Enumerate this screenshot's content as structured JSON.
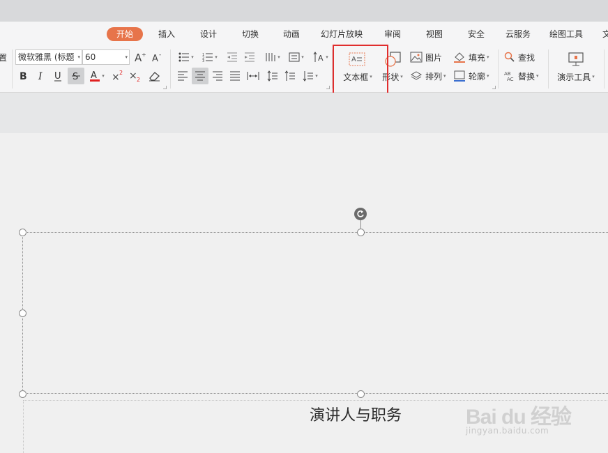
{
  "tabs": [
    {
      "label": "开始",
      "active": true
    },
    {
      "label": "插入"
    },
    {
      "label": "设计"
    },
    {
      "label": "切换"
    },
    {
      "label": "动画"
    },
    {
      "label": "幻灯片放映"
    },
    {
      "label": "审阅"
    },
    {
      "label": "视图"
    },
    {
      "label": "安全"
    },
    {
      "label": "云服务"
    },
    {
      "label": "绘图工具"
    },
    {
      "label": "文"
    }
  ],
  "ribbon": {
    "partial_label": "置",
    "font_name": "微软雅黑 (标题",
    "font_size": "60",
    "text_box_label": "文本框",
    "shape_label": "形状",
    "picture_label": "图片",
    "arrange_label": "排列",
    "fill_label": "填充",
    "outline_label": "轮廓",
    "find_label": "查找",
    "replace_label": "替换",
    "present_tools_label": "演示工具"
  },
  "slide": {
    "subtitle_text": "演讲人与职务"
  },
  "watermark": {
    "logo_text": "Bai du 经验",
    "url": "jingyan.baidu.com"
  },
  "colors": {
    "active_tab": "#e7744a",
    "highlight_box": "#e02d2d",
    "font_color_underline": "#e02020"
  }
}
